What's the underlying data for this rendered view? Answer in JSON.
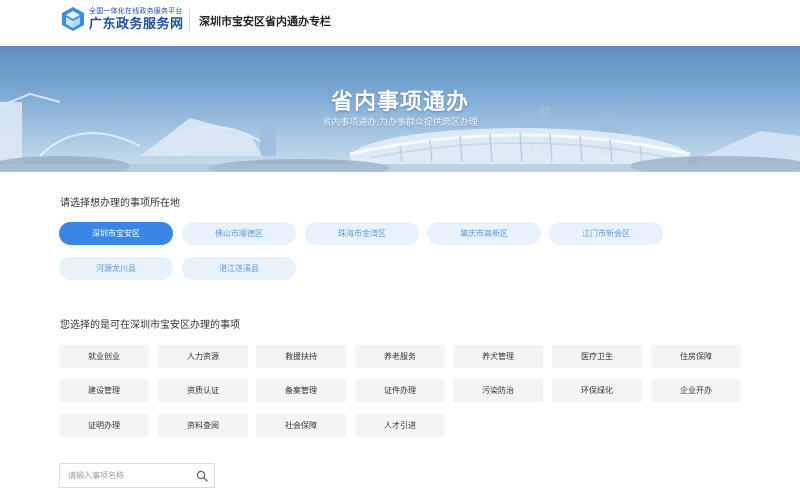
{
  "header": {
    "logo_subtitle": "全国一体化在线政务服务平台",
    "logo_title": "广东政务服务网",
    "section_title": "深圳市宝安区省内通办专栏"
  },
  "banner": {
    "title": "省内事项通办",
    "subtitle": "省内事项通办,为办事群众提供跨区办理"
  },
  "location": {
    "label": "请选择想办理的事项所在地",
    "selected": "深圳市宝安区",
    "options": [
      "深圳市宝安区",
      "佛山市顺德区",
      "珠海市金湾区",
      "肇庆市高新区",
      "江门市新会区",
      "河源龙川县",
      "湛江遂溪县"
    ]
  },
  "items": {
    "label": "您选择的是可在深圳市宝安区办理的事项",
    "list": [
      "就业创业",
      "人力资源",
      "救援扶持",
      "养老服务",
      "养犬管理",
      "医疗卫生",
      "住房保障",
      "建设管理",
      "资质认证",
      "备案管理",
      "证件办理",
      "污染防治",
      "环保绿化",
      "企业开办",
      "证明办理",
      "资料查阅",
      "社会保障",
      "人才引进"
    ]
  },
  "search": {
    "placeholder": "请输入事项名称",
    "value": "",
    "icon": "search-icon"
  },
  "colors": {
    "brand": "#1f4f9c",
    "accent": "#3a86e6",
    "chip_bg": "#e8f2fc",
    "chip_text": "#5f9ad8",
    "item_bg": "#f3f4f6"
  }
}
